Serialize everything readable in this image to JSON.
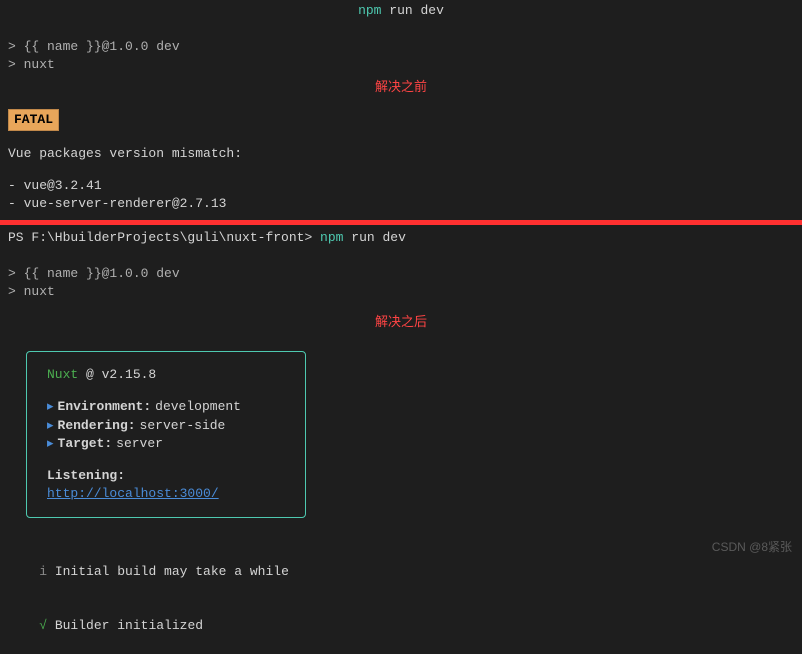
{
  "top": {
    "prefix": "npm",
    "suffix": " run dev"
  },
  "block1": {
    "l1": "> {{ name }}@1.0.0 dev",
    "l2": "> nuxt"
  },
  "anno1": "解决之前",
  "fatal": "FATAL",
  "mismatch": {
    "title": "Vue packages version mismatch:",
    "pkg1": "- vue@3.2.41",
    "pkg2": "- vue-server-renderer@2.7.13"
  },
  "pathline": {
    "prompt": "PS F:\\HbuilderProjects\\guli\\nuxt-front>",
    "cmd1": " npm",
    "cmd2": " run dev"
  },
  "block2": {
    "l1": "> {{ name }}@1.0.0 dev",
    "l2": "> nuxt"
  },
  "anno2": "解决之后",
  "box": {
    "name": "Nuxt",
    "version": " @ v2.15.8",
    "arrow": "▸",
    "env_label": " Environment:",
    "env_val": " development",
    "render_label": " Rendering:  ",
    "render_val": " server-side",
    "target_label": " Target:     ",
    "target_val": " server",
    "listen_label": "Listening: ",
    "listen_url": "http://localhost:3000/"
  },
  "status": {
    "i": "i",
    "msg1": " Initial build may take a while",
    "check": "√",
    "msg2": " Builder initialized"
  },
  "watermark": "CSDN @8紧张"
}
